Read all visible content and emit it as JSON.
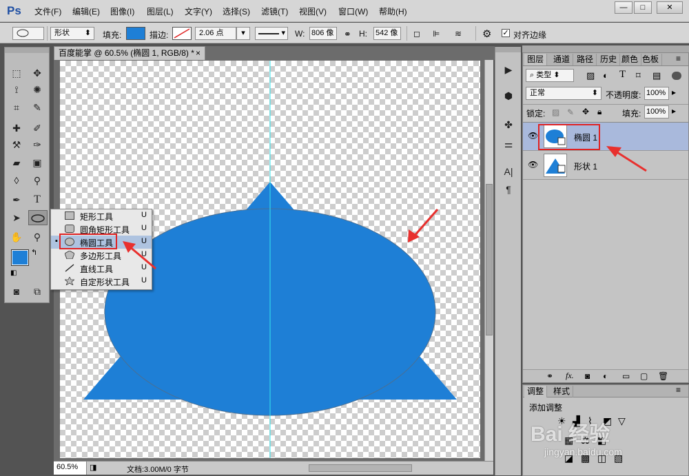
{
  "app": {
    "logo": "Ps"
  },
  "menu": [
    "文件(F)",
    "编辑(E)",
    "图像(I)",
    "图层(L)",
    "文字(Y)",
    "选择(S)",
    "滤镜(T)",
    "视图(V)",
    "窗口(W)",
    "帮助(H)"
  ],
  "window_controls": {
    "minimize": "—",
    "maximize": "□",
    "close": "✕"
  },
  "options": {
    "mode": "形状",
    "fill_label": "填充:",
    "fill_color": "#1e7fd6",
    "stroke_label": "描边:",
    "stroke_width": "2.06 点",
    "w_label": "W:",
    "w_value": "806 像",
    "h_label": "H:",
    "h_value": "542 像",
    "align_edges": "对齐边缘"
  },
  "doc": {
    "tab_title": "百度能掌 @ 60.5% (椭圆 1, RGB/8) *",
    "close": "×",
    "zoom": "60.5%",
    "doc_info": "文档:3.00M/0 字节",
    "shape_color": "#1e7fd6"
  },
  "flyout": {
    "items": [
      {
        "label": "矩形工具",
        "shortcut": "U",
        "icon": "rectangle-icon",
        "active": false
      },
      {
        "label": "圆角矩形工具",
        "shortcut": "U",
        "icon": "rounded-rectangle-icon",
        "active": false
      },
      {
        "label": "椭圆工具",
        "shortcut": "U",
        "icon": "ellipse-icon",
        "active": true
      },
      {
        "label": "多边形工具",
        "shortcut": "U",
        "icon": "polygon-icon",
        "active": false
      },
      {
        "label": "直线工具",
        "shortcut": "U",
        "icon": "line-icon",
        "active": false
      },
      {
        "label": "自定形状工具",
        "shortcut": "U",
        "icon": "custom-shape-icon",
        "active": false
      }
    ]
  },
  "colors": {
    "foreground": "#1e7fd6",
    "background": "#000000"
  },
  "layers_panel": {
    "tabs": [
      "图层",
      "通道",
      "路径",
      "历史",
      "颜色",
      "色板"
    ],
    "filter": "类型",
    "blend_mode": "正常",
    "opacity_label": "不透明度:",
    "opacity": "100%",
    "lock_label": "锁定:",
    "fill_label": "填充:",
    "fill": "100%",
    "layers": [
      {
        "name": "椭圆 1",
        "selected": true
      },
      {
        "name": "形状 1",
        "selected": false
      }
    ]
  },
  "adjust_panel": {
    "tabs": [
      "调整",
      "样式"
    ],
    "title": "添加调整"
  },
  "watermark": {
    "line1": "Bai 经验",
    "line2": "jingyan.baidu.com"
  }
}
